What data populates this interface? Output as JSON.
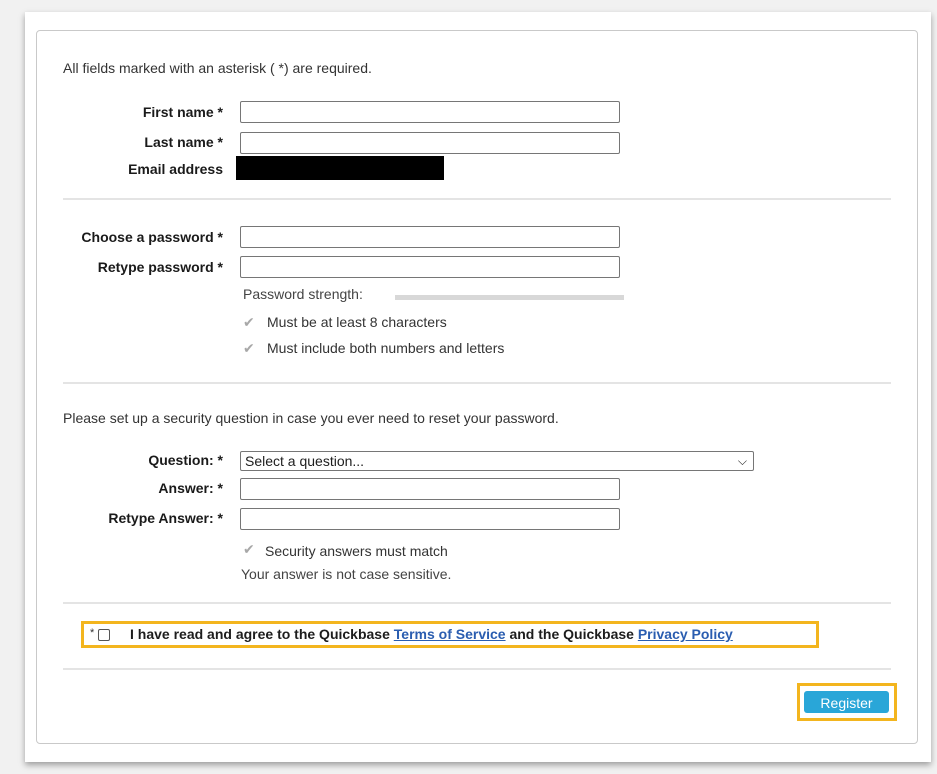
{
  "intro": "All fields marked with an asterisk ( *) are required.",
  "name_section": {
    "first_name_label": "First name *",
    "first_name_value": "",
    "last_name_label": "Last name *",
    "last_name_value": "",
    "email_label": "Email address"
  },
  "password_section": {
    "choose_label": "Choose a password *",
    "retype_label": "Retype password *",
    "strength_label": "Password strength:",
    "rule_length": "Must be at least 8 characters",
    "rule_mix": "Must include both numbers and letters"
  },
  "security_section": {
    "intro": "Please set up a security question in case you ever need to reset your password.",
    "question_label": "Question: *",
    "question_selected": "Select a question...",
    "answer_label": "Answer: *",
    "retype_answer_label": "Retype Answer: *",
    "rule_match": "Security answers must match",
    "case_note": "Your answer is not case sensitive."
  },
  "agreement": {
    "asterisk": "*",
    "text_before": "I have read and agree to the Quickbase ",
    "terms_link": "Terms of Service",
    "text_middle": " and the Quickbase ",
    "privacy_link": "Privacy Policy"
  },
  "register_label": "Register",
  "colors": {
    "highlight": "#f3b51e",
    "button": "#29a6d8",
    "link": "#2a5db0"
  }
}
